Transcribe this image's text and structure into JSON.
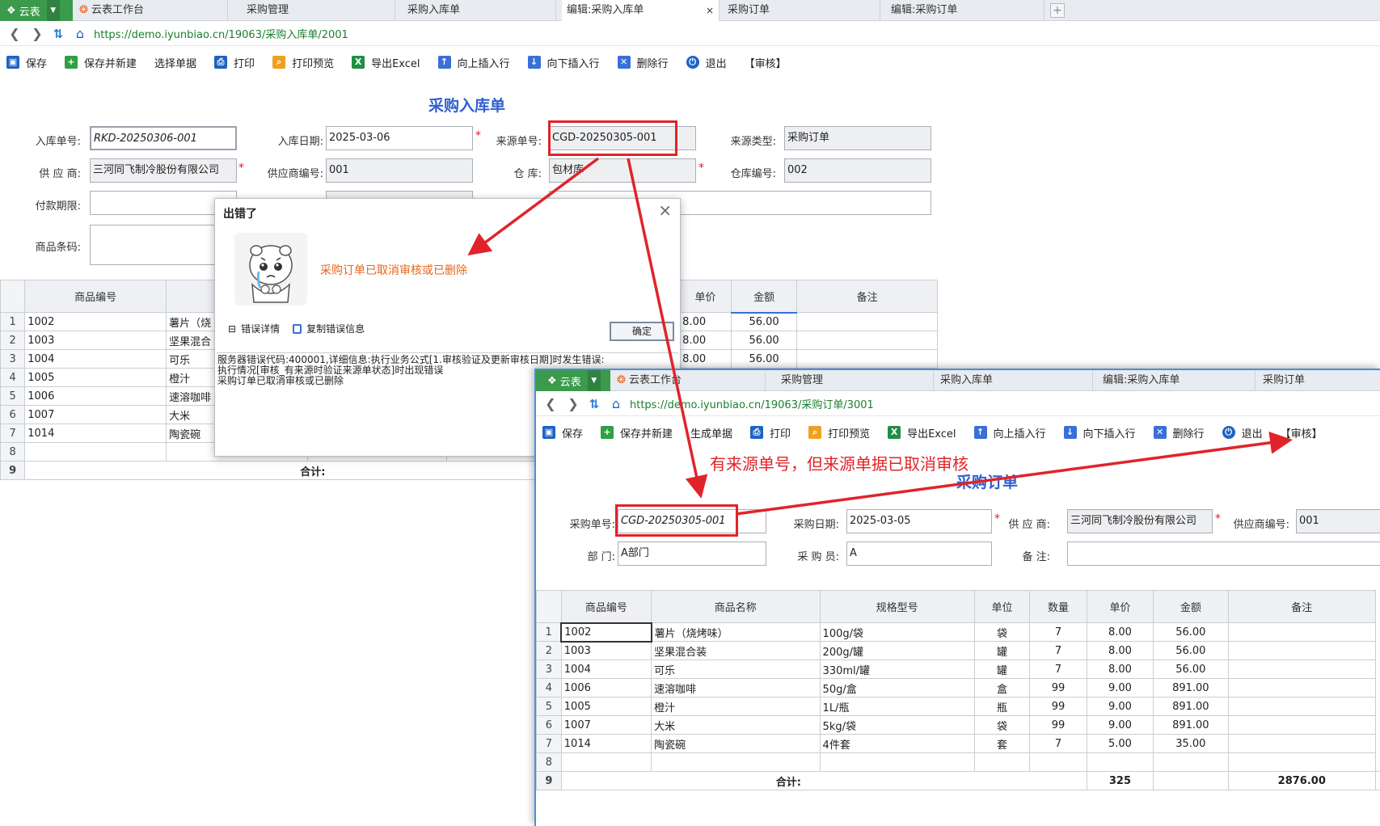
{
  "win1": {
    "brand": "云表",
    "tabs": [
      "云表工作台",
      "采购管理",
      "采购入库单",
      "编辑:采购入库单",
      "采购订单",
      "编辑:采购订单"
    ],
    "close_glyph": "×",
    "url": "https://demo.iyunbiao.cn/19063/采购入库单/2001",
    "toolbar": [
      "保存",
      "保存并新建",
      "选择单据",
      "打印",
      "打印预览",
      "导出Excel",
      "向上插入行",
      "向下插入行",
      "删除行",
      "退出",
      "【审核】"
    ],
    "title": "采购入库单",
    "form": {
      "rk_no_label": "入库单号:",
      "rk_no": "RKD-20250306-001",
      "rk_date_label": "入库日期:",
      "rk_date": "2025-03-06",
      "src_no_label": "来源单号:",
      "src_no": "CGD-20250305-001",
      "src_type_label": "来源类型:",
      "src_type": "采购订单",
      "supplier_label": "供 应 商:",
      "supplier": "三河同飞制冷股份有限公司",
      "supplier_code_label": "供应商编号:",
      "supplier_code": "001",
      "warehouse_label": "仓      库:",
      "warehouse": "包材库",
      "warehouse_code_label": "仓库编号:",
      "warehouse_code": "002",
      "pay_label": "付款期限:",
      "barcode_label": "商品条码:"
    },
    "grid": {
      "headers": [
        "商品编号",
        "单价",
        "金额",
        "备注"
      ],
      "rows": [
        {
          "n": "1",
          "code": "1002",
          "name": "薯片（烧",
          "price": "8.00",
          "amt": "56.00"
        },
        {
          "n": "2",
          "code": "1003",
          "name": "坚果混合",
          "price": "8.00",
          "amt": "56.00"
        },
        {
          "n": "3",
          "code": "1004",
          "name": "可乐",
          "price": "8.00",
          "amt": "56.00"
        },
        {
          "n": "4",
          "code": "1005",
          "name": "橙汁",
          "price": "",
          "amt": ""
        },
        {
          "n": "5",
          "code": "1006",
          "name": "速溶咖啡",
          "price": "",
          "amt": ""
        },
        {
          "n": "6",
          "code": "1007",
          "name": "大米",
          "price": "",
          "amt": ""
        },
        {
          "n": "7",
          "code": "1014",
          "name": "陶瓷碗",
          "price": "",
          "amt": ""
        },
        {
          "n": "8",
          "code": "",
          "name": "",
          "price": "",
          "amt": ""
        }
      ],
      "total_row_no": "9",
      "total_label": "合计:"
    }
  },
  "dialog": {
    "title": "出错了",
    "close_glyph": "×",
    "message": "采购订单已取消审核或已删除",
    "details_toggle": "⊟",
    "details_label": "错误详情",
    "copy_label": "复制错误信息",
    "ok": "确定",
    "detail_lines": [
      "服务器错误代码:400001,详细信息:执行业务公式[1.审核验证及更新审核日期]时发生错误:",
      "执行情况[审核_有来源时验证来源单状态]时出现错误",
      "采购订单已取消审核或已删除"
    ]
  },
  "win2": {
    "brand": "云表",
    "tabs": [
      "云表工作台",
      "采购管理",
      "采购入库单",
      "编辑:采购入库单",
      "采购订单"
    ],
    "url": "https://demo.iyunbiao.cn/19063/采购订单/3001",
    "toolbar": [
      "保存",
      "保存并新建",
      "生成单据",
      "打印",
      "打印预览",
      "导出Excel",
      "向上插入行",
      "向下插入行",
      "删除行",
      "退出",
      "【审核】"
    ],
    "title": "采购订单",
    "form": {
      "po_no_label": "采购单号:",
      "po_no": "CGD-20250305-001",
      "po_date_label": "采购日期:",
      "po_date": "2025-03-05",
      "supplier_label": "供 应 商:",
      "supplier": "三河同飞制冷股份有限公司",
      "supplier_code_label": "供应商编号:",
      "supplier_code": "001",
      "dept_label": "部      门:",
      "dept": "A部门",
      "buyer_label": "采 购 员:",
      "buyer": "A",
      "remark_label": "备      注:"
    },
    "grid": {
      "headers": [
        "商品编号",
        "商品名称",
        "规格型号",
        "单位",
        "数量",
        "单价",
        "金额",
        "备注"
      ],
      "rows": [
        {
          "n": "1",
          "code": "1002",
          "name": "薯片（烧烤味）",
          "spec": "100g/袋",
          "unit": "袋",
          "qty": "7",
          "price": "8.00",
          "amt": "56.00"
        },
        {
          "n": "2",
          "code": "1003",
          "name": "坚果混合装",
          "spec": "200g/罐",
          "unit": "罐",
          "qty": "7",
          "price": "8.00",
          "amt": "56.00"
        },
        {
          "n": "3",
          "code": "1004",
          "name": "可乐",
          "spec": "330ml/罐",
          "unit": "罐",
          "qty": "7",
          "price": "8.00",
          "amt": "56.00"
        },
        {
          "n": "4",
          "code": "1006",
          "name": "速溶咖啡",
          "spec": "50g/盒",
          "unit": "盒",
          "qty": "99",
          "price": "9.00",
          "amt": "891.00"
        },
        {
          "n": "5",
          "code": "1005",
          "name": "橙汁",
          "spec": "1L/瓶",
          "unit": "瓶",
          "qty": "99",
          "price": "9.00",
          "amt": "891.00"
        },
        {
          "n": "6",
          "code": "1007",
          "name": "大米",
          "spec": "5kg/袋",
          "unit": "袋",
          "qty": "99",
          "price": "9.00",
          "amt": "891.00"
        },
        {
          "n": "7",
          "code": "1014",
          "name": "陶瓷碗",
          "spec": "4件套",
          "unit": "套",
          "qty": "7",
          "price": "5.00",
          "amt": "35.00"
        },
        {
          "n": "8",
          "code": "",
          "name": "",
          "spec": "",
          "unit": "",
          "qty": "",
          "price": "",
          "amt": ""
        }
      ],
      "total_row_no": "9",
      "total_label": "合计:",
      "total_qty": "325",
      "total_amt": "2876.00"
    }
  },
  "annotation": "有来源单号，但来源单据已取消审核",
  "colors": {
    "brand": "#3b9a4b",
    "title": "#2f5fd0",
    "annotation": "#e0242a",
    "url": "#1a7f2e",
    "error_msg": "#e8641c"
  }
}
